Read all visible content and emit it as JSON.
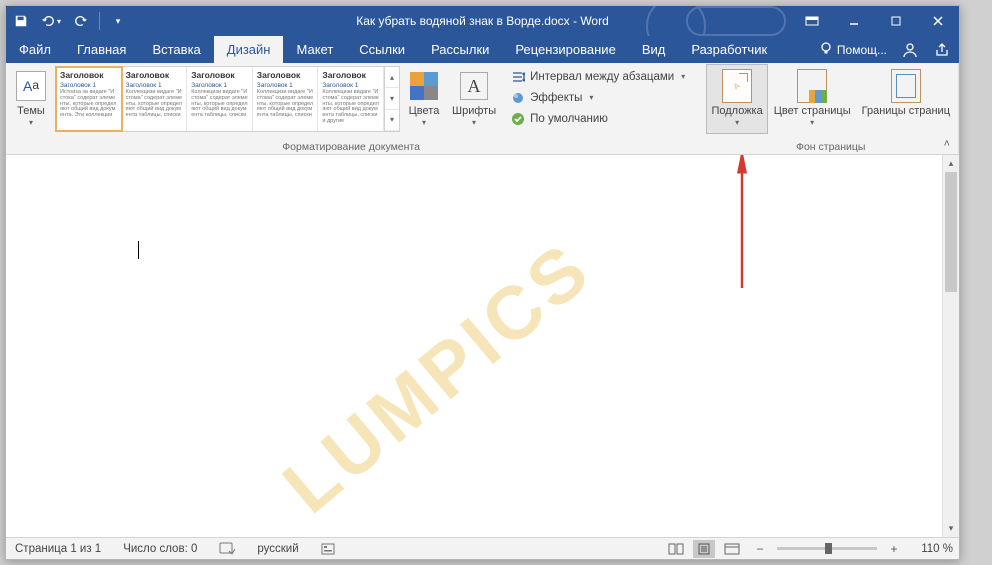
{
  "title": "Как убрать водяной знак в Ворде.docx - Word",
  "qat": {
    "save": "💾",
    "undo": "↶",
    "redo": "↷",
    "touch": ""
  },
  "tabs": {
    "file": "Файл",
    "items": [
      "Главная",
      "Вставка",
      "Дизайн",
      "Макет",
      "Ссылки",
      "Рассылки",
      "Рецензирование",
      "Вид",
      "Разработчик"
    ],
    "active_index": 2,
    "tell_me": "Помощ..."
  },
  "ribbon": {
    "themes_label": "Темы",
    "gallery_heading": "Заголовок",
    "gallery_sub": "Заголовок 1",
    "formatting_group": "Форматирование документа",
    "colors": "Цвета",
    "fonts": "Шрифты",
    "para_spacing": "Интервал между абзацами",
    "effects": "Эффекты",
    "set_default": "По умолчанию",
    "bg_group": "Фон страницы",
    "watermark": "Подложка",
    "page_color": "Цвет страницы",
    "page_borders": "Границы страниц"
  },
  "document": {
    "watermark_text": "LUMPICS"
  },
  "status": {
    "page": "Страница 1 из 1",
    "words": "Число слов: 0",
    "lang": "русский",
    "zoom": "110 %"
  }
}
